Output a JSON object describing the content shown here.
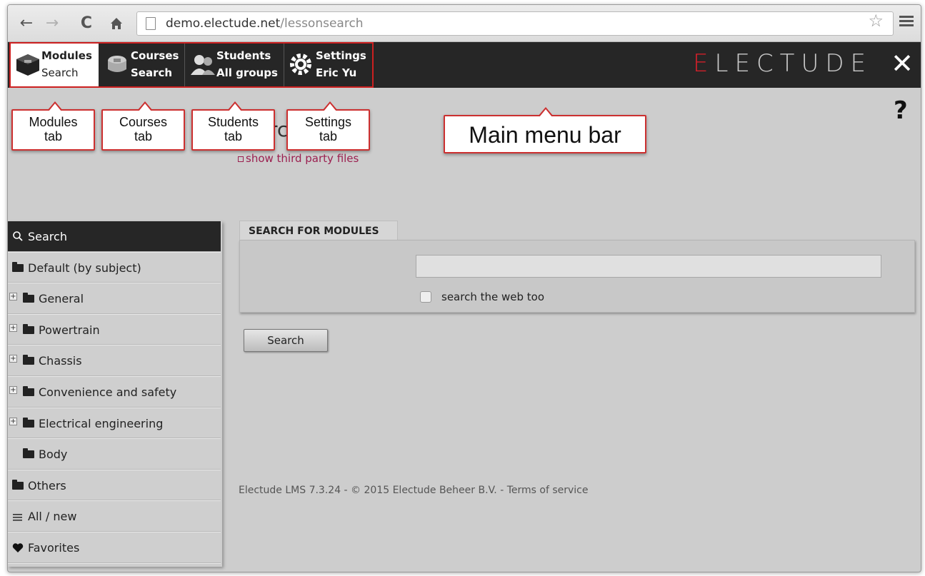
{
  "browser": {
    "url_host": "demo.electude.net",
    "url_path": "/lessonsearch"
  },
  "header": {
    "tabs": [
      {
        "line1": "Modules",
        "line2": "Search"
      },
      {
        "line1": "Courses",
        "line2": "Search"
      },
      {
        "line1": "Students",
        "line2": "All groups"
      },
      {
        "line1": "Settings",
        "line2": "Eric Yu"
      }
    ],
    "brand_first": "E",
    "brand_rest": "LECTUDE",
    "close_glyph": "✕"
  },
  "callouts": {
    "modules": [
      "Modules",
      "tab"
    ],
    "courses": [
      "Courses",
      "tab"
    ],
    "students": [
      "Students",
      "tab"
    ],
    "settings": [
      "Settings",
      "tab"
    ],
    "main": "Main menu bar"
  },
  "page": {
    "help": "?",
    "title_fragment": "rc",
    "third_party_link": "show third party files"
  },
  "sidebar": {
    "items": [
      {
        "label": "Search",
        "icon": "search-icon"
      },
      {
        "label": "Default (by subject)",
        "icon": "folder-icon"
      },
      {
        "label": "General",
        "icon": "folder-icon",
        "expandable": true
      },
      {
        "label": "Powertrain",
        "icon": "folder-icon",
        "expandable": true
      },
      {
        "label": "Chassis",
        "icon": "folder-icon",
        "expandable": true
      },
      {
        "label": "Convenience and safety",
        "icon": "folder-icon",
        "expandable": true
      },
      {
        "label": "Electrical engineering",
        "icon": "folder-icon",
        "expandable": true
      },
      {
        "label": "Body",
        "icon": "folder-icon"
      },
      {
        "label": "Others",
        "icon": "folder-icon"
      },
      {
        "label": "All / new",
        "icon": "list-icon"
      },
      {
        "label": "Favorites",
        "icon": "heart-icon"
      }
    ]
  },
  "search_panel": {
    "tab_label": "SEARCH FOR MODULES",
    "input_value": "",
    "web_checkbox_label": "search the web too",
    "web_checkbox_checked": false,
    "button_label": "Search"
  },
  "footer": {
    "text": "Electude LMS 7.3.24 - © 2015 Electude Beheer B.V. - Terms of service"
  },
  "colors": {
    "brand_red": "#d0202a",
    "callout_border": "#cc3030",
    "header_bg": "#262626"
  }
}
